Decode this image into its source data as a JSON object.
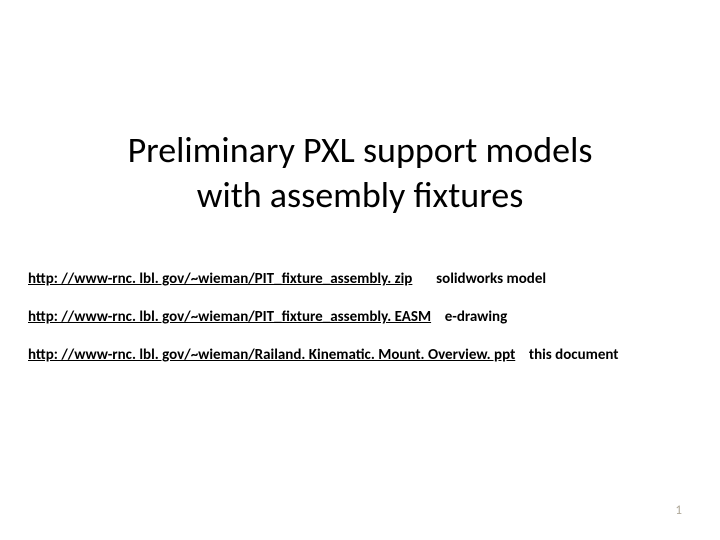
{
  "title_line1": "Preliminary PXL support models",
  "title_line2": "with assembly fixtures",
  "links": [
    {
      "url": "http: //www-rnc. lbl. gov/~wieman/PIT_fixture_assembly. zip",
      "desc": "solidworks model"
    },
    {
      "url": "http: //www-rnc. lbl. gov/~wieman/PIT_fixture_assembly. EASM",
      "desc": "e-drawing"
    },
    {
      "url": "http: //www-rnc. lbl. gov/~wieman/Railand. Kinematic. Mount. Overview. ppt",
      "desc": "this document"
    }
  ],
  "page_number": "1"
}
